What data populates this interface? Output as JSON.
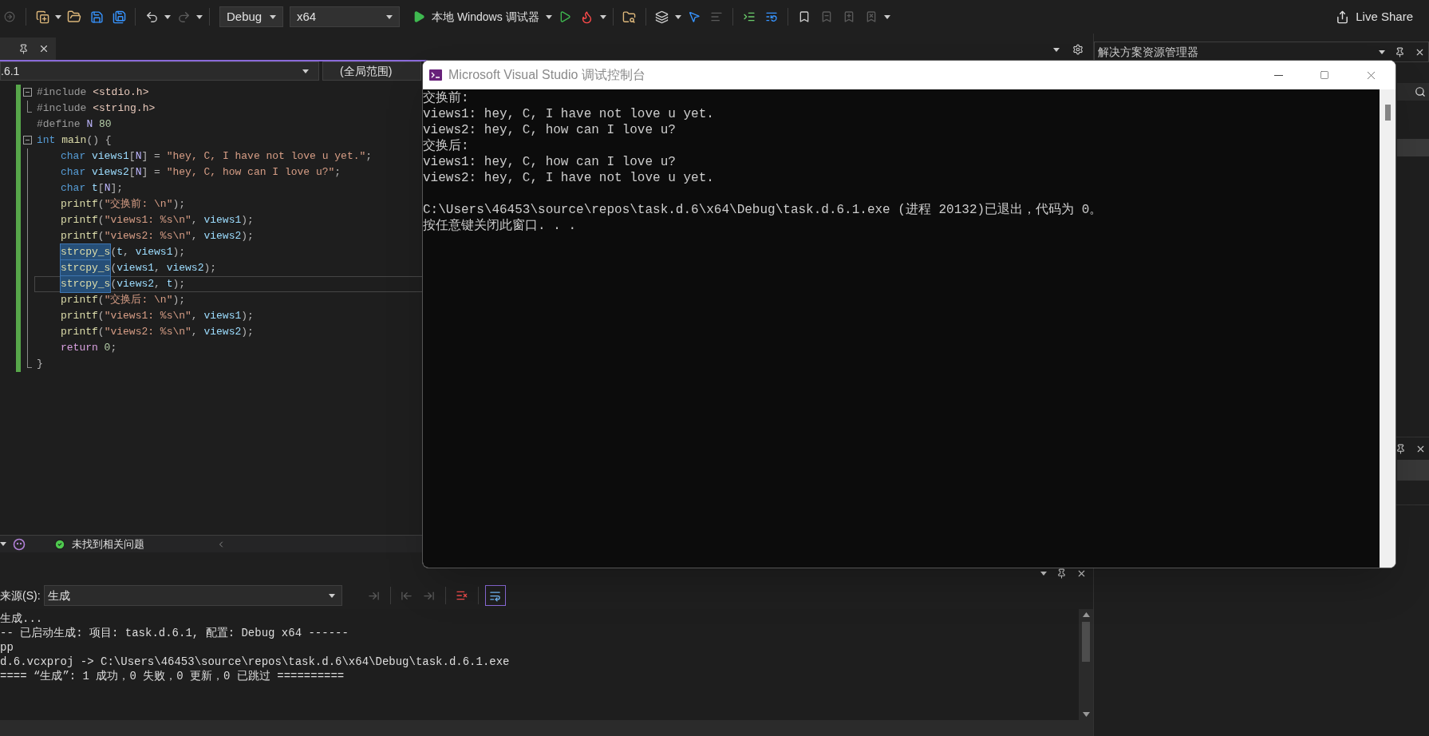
{
  "toolbar": {
    "configuration": "Debug",
    "platform": "x64",
    "debugger": "本地 Windows 调试器",
    "live_share": "Live Share"
  },
  "editor": {
    "project": ".6.1",
    "scope": "(全局范围)",
    "status": "未找到相关问题",
    "lines": [
      {
        "kind": "fold_start",
        "indented": false,
        "current": false,
        "tokens": [
          {
            "text": "#include ",
            "kind": "pre"
          },
          {
            "text": "<stdio.h>",
            "kind": "hdr"
          }
        ]
      },
      {
        "kind": "fold_end",
        "indented": false,
        "current": false,
        "tokens": [
          {
            "text": "#include ",
            "kind": "pre"
          },
          {
            "text": "<string.h>",
            "kind": "hdr"
          }
        ]
      },
      {
        "kind": "plain",
        "indented": false,
        "current": false,
        "tokens": [
          {
            "text": "#define ",
            "kind": "pre"
          },
          {
            "text": "N ",
            "kind": "macro"
          },
          {
            "text": "80",
            "kind": "num"
          }
        ]
      },
      {
        "kind": "fold_start",
        "indented": false,
        "current": false,
        "tokens": [
          {
            "text": "int ",
            "kind": "kw"
          },
          {
            "text": "main",
            "kind": "fn"
          },
          {
            "text": "() {",
            "kind": "p"
          }
        ]
      },
      {
        "kind": "guide",
        "indented": true,
        "current": false,
        "tokens": [
          {
            "text": "char ",
            "kind": "kw"
          },
          {
            "text": "views1",
            "kind": "var"
          },
          {
            "text": "[",
            "kind": "p"
          },
          {
            "text": "N",
            "kind": "macro"
          },
          {
            "text": "] = ",
            "kind": "p"
          },
          {
            "text": "\"hey, C, I have not love u yet.\"",
            "kind": "str"
          },
          {
            "text": ";",
            "kind": "p"
          }
        ]
      },
      {
        "kind": "guide",
        "indented": true,
        "current": false,
        "tokens": [
          {
            "text": "char ",
            "kind": "kw"
          },
          {
            "text": "views2",
            "kind": "var"
          },
          {
            "text": "[",
            "kind": "p"
          },
          {
            "text": "N",
            "kind": "macro"
          },
          {
            "text": "] = ",
            "kind": "p"
          },
          {
            "text": "\"hey, C, how can I love u?\"",
            "kind": "str"
          },
          {
            "text": ";",
            "kind": "p"
          }
        ]
      },
      {
        "kind": "guide",
        "indented": true,
        "current": false,
        "tokens": [
          {
            "text": "char ",
            "kind": "kw"
          },
          {
            "text": "t",
            "kind": "var"
          },
          {
            "text": "[",
            "kind": "p"
          },
          {
            "text": "N",
            "kind": "macro"
          },
          {
            "text": "];",
            "kind": "p"
          }
        ]
      },
      {
        "kind": "guide",
        "indented": true,
        "current": false,
        "tokens": [
          {
            "text": "printf",
            "kind": "fn"
          },
          {
            "text": "(",
            "kind": "p"
          },
          {
            "text": "\"交换前: \\n\"",
            "kind": "str"
          },
          {
            "text": ");",
            "kind": "p"
          }
        ]
      },
      {
        "kind": "guide",
        "indented": true,
        "current": false,
        "tokens": [
          {
            "text": "printf",
            "kind": "fn"
          },
          {
            "text": "(",
            "kind": "p"
          },
          {
            "text": "\"views1: %s\\n\"",
            "kind": "str"
          },
          {
            "text": ", ",
            "kind": "p"
          },
          {
            "text": "views1",
            "kind": "var"
          },
          {
            "text": ");",
            "kind": "p"
          }
        ]
      },
      {
        "kind": "guide",
        "indented": true,
        "current": false,
        "tokens": [
          {
            "text": "printf",
            "kind": "fn"
          },
          {
            "text": "(",
            "kind": "p"
          },
          {
            "text": "\"views2: %s\\n\"",
            "kind": "str"
          },
          {
            "text": ", ",
            "kind": "p"
          },
          {
            "text": "views2",
            "kind": "var"
          },
          {
            "text": ");",
            "kind": "p"
          }
        ]
      },
      {
        "kind": "guide",
        "indented": true,
        "current": false,
        "tokens": [
          {
            "text": "strcpy_s",
            "kind": "match"
          },
          {
            "text": "(",
            "kind": "p"
          },
          {
            "text": "t",
            "kind": "var"
          },
          {
            "text": ", ",
            "kind": "p"
          },
          {
            "text": "views1",
            "kind": "var"
          },
          {
            "text": ");",
            "kind": "p"
          }
        ]
      },
      {
        "kind": "guide",
        "indented": true,
        "current": false,
        "tokens": [
          {
            "text": "strcpy_s",
            "kind": "match"
          },
          {
            "text": "(",
            "kind": "p"
          },
          {
            "text": "views1",
            "kind": "var"
          },
          {
            "text": ", ",
            "kind": "p"
          },
          {
            "text": "views2",
            "kind": "var"
          },
          {
            "text": ");",
            "kind": "p"
          }
        ]
      },
      {
        "kind": "guide",
        "indented": true,
        "current": true,
        "tokens": [
          {
            "text": "strcpy_s",
            "kind": "match"
          },
          {
            "text": "(",
            "kind": "p"
          },
          {
            "text": "views2",
            "kind": "var"
          },
          {
            "text": ", ",
            "kind": "p"
          },
          {
            "text": "t",
            "kind": "var"
          },
          {
            "text": ");",
            "kind": "p"
          }
        ]
      },
      {
        "kind": "guide",
        "indented": true,
        "current": false,
        "tokens": [
          {
            "text": "printf",
            "kind": "fn"
          },
          {
            "text": "(",
            "kind": "p"
          },
          {
            "text": "\"交换后: \\n\"",
            "kind": "str"
          },
          {
            "text": ");",
            "kind": "p"
          }
        ]
      },
      {
        "kind": "guide",
        "indented": true,
        "current": false,
        "tokens": [
          {
            "text": "printf",
            "kind": "fn"
          },
          {
            "text": "(",
            "kind": "p"
          },
          {
            "text": "\"views1: %s\\n\"",
            "kind": "str"
          },
          {
            "text": ", ",
            "kind": "p"
          },
          {
            "text": "views1",
            "kind": "var"
          },
          {
            "text": ");",
            "kind": "p"
          }
        ]
      },
      {
        "kind": "guide",
        "indented": true,
        "current": false,
        "tokens": [
          {
            "text": "printf",
            "kind": "fn"
          },
          {
            "text": "(",
            "kind": "p"
          },
          {
            "text": "\"views2: %s\\n\"",
            "kind": "str"
          },
          {
            "text": ", ",
            "kind": "p"
          },
          {
            "text": "views2",
            "kind": "var"
          },
          {
            "text": ");",
            "kind": "p"
          }
        ]
      },
      {
        "kind": "guide",
        "indented": true,
        "current": false,
        "tokens": [
          {
            "text": "return ",
            "kind": "ctl"
          },
          {
            "text": "0",
            "kind": "num"
          },
          {
            "text": ";",
            "kind": "p"
          }
        ]
      },
      {
        "kind": "fold_end",
        "indented": false,
        "current": false,
        "tokens": [
          {
            "text": "}",
            "kind": "p"
          }
        ]
      }
    ]
  },
  "console": {
    "title": "Microsoft Visual Studio 调试控制台",
    "blocks": [
      [
        "交换前:",
        "views1: hey, C, I have not love u yet.",
        "views2: hey, C, how can I love u?",
        "交换后:",
        "views1: hey, C, how can I love u?",
        "views2: hey, C, I have not love u yet."
      ],
      [
        "C:\\Users\\46453\\source\\repos\\task.d.6\\x64\\Debug\\task.d.6.1.exe (进程 20132)已退出，代码为 0。",
        "按任意键关闭此窗口. . ."
      ]
    ]
  },
  "output": {
    "source_label": "来源(S):",
    "source": "生成",
    "lines": [
      "生成...",
      "-- 已启动生成: 项目: task.d.6.1, 配置: Debug x64 ------",
      "pp",
      "d.6.vcxproj -> C:\\Users\\46453\\source\\repos\\task.d.6\\x64\\Debug\\task.d.6.1.exe",
      "==== “生成”: 1 成功，0 失败，0 更新，0 已跳过 =========="
    ]
  },
  "solution_explorer": {
    "title": "解决方案资源管理器"
  }
}
